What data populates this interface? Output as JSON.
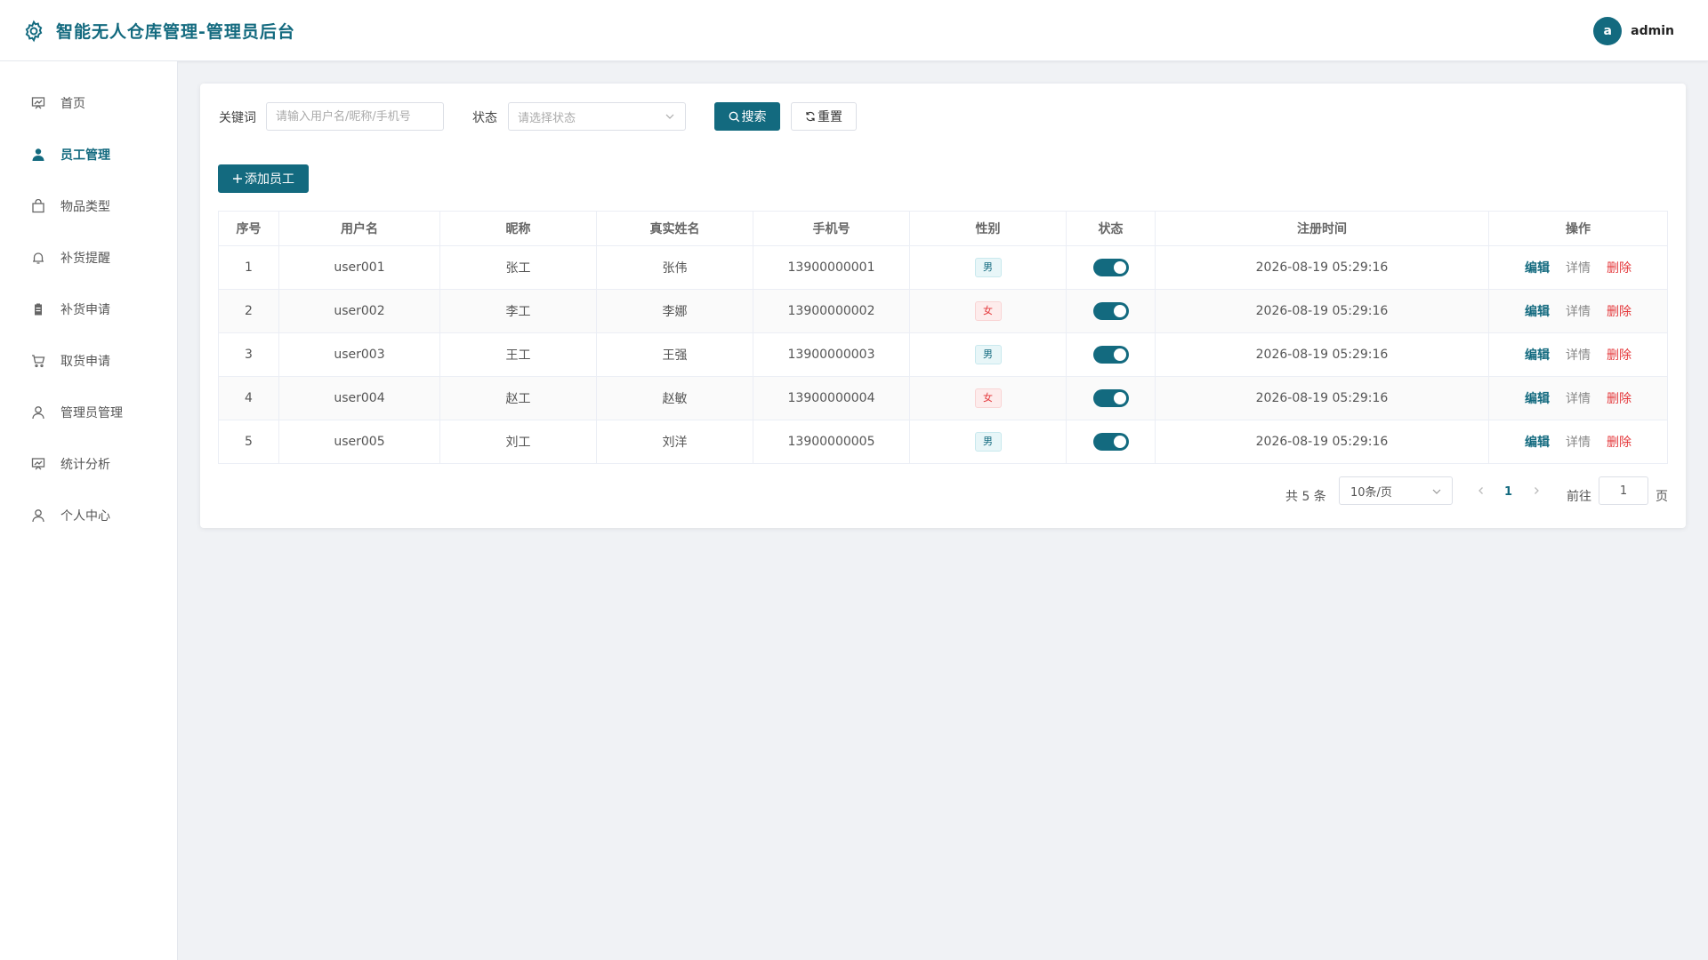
{
  "header": {
    "title": "智能无人仓库管理-管理员后台",
    "avatar_letter": "a",
    "username": "admin"
  },
  "sidebar": {
    "items": [
      {
        "label": "首页",
        "icon": "dashboard-icon"
      },
      {
        "label": "员工管理",
        "icon": "user-filled-icon",
        "active": true
      },
      {
        "label": "物品类型",
        "icon": "shopping-bag-icon"
      },
      {
        "label": "补货提醒",
        "icon": "bell-icon"
      },
      {
        "label": "补货申请",
        "icon": "clipboard-icon"
      },
      {
        "label": "取货申请",
        "icon": "cart-icon"
      },
      {
        "label": "管理员管理",
        "icon": "user-icon"
      },
      {
        "label": "统计分析",
        "icon": "chart-board-icon"
      },
      {
        "label": "个人中心",
        "icon": "user-icon"
      }
    ]
  },
  "filters": {
    "keyword_label": "关键词",
    "keyword_placeholder": "请输入用户名/昵称/手机号",
    "keyword_value": "",
    "status_label": "状态",
    "status_placeholder": "请选择状态",
    "search_label": "搜索",
    "reset_label": "重置"
  },
  "actions": {
    "add_label": "添加员工"
  },
  "table": {
    "columns": [
      "序号",
      "用户名",
      "昵称",
      "真实姓名",
      "手机号",
      "性别",
      "状态",
      "注册时间",
      "操作"
    ],
    "rows": [
      {
        "index": "1",
        "username": "user001",
        "nickname": "张工",
        "realname": "张伟",
        "phone": "13900000001",
        "gender": "男",
        "status_on": true,
        "registered": "2026-08-19 05:29:16"
      },
      {
        "index": "2",
        "username": "user002",
        "nickname": "李工",
        "realname": "李娜",
        "phone": "13900000002",
        "gender": "女",
        "status_on": true,
        "registered": "2026-08-19 05:29:16"
      },
      {
        "index": "3",
        "username": "user003",
        "nickname": "王工",
        "realname": "王强",
        "phone": "13900000003",
        "gender": "男",
        "status_on": true,
        "registered": "2026-08-19 05:29:16"
      },
      {
        "index": "4",
        "username": "user004",
        "nickname": "赵工",
        "realname": "赵敏",
        "phone": "13900000004",
        "gender": "女",
        "status_on": true,
        "registered": "2026-08-19 05:29:16"
      },
      {
        "index": "5",
        "username": "user005",
        "nickname": "刘工",
        "realname": "刘洋",
        "phone": "13900000005",
        "gender": "男",
        "status_on": true,
        "registered": "2026-08-19 05:29:16"
      }
    ],
    "op_edit": "编辑",
    "op_detail": "详情",
    "op_delete": "删除"
  },
  "pagination": {
    "total_text": "共 5 条",
    "page_size": "10条/页",
    "current_page": "1",
    "goto_label": "前往",
    "goto_value": "1",
    "page_suffix": "页"
  },
  "colors": {
    "primary": "#136a7f",
    "danger": "#e4393c"
  }
}
